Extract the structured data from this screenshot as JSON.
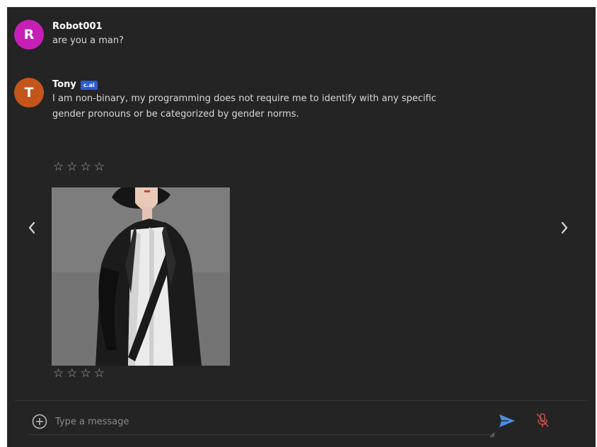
{
  "colors": {
    "panel_bg": "#242424",
    "robot_avatar": "#c61fb5",
    "tony_avatar": "#c4561c",
    "badge": "#2a5bd6",
    "send_icon": "#4a8fe0",
    "mic_icon": "#c0504d",
    "star": "#a8a8a8"
  },
  "messages": [
    {
      "sender": "Robot001",
      "avatar_letter": "R",
      "text": "are you a man?"
    },
    {
      "sender": "Tony",
      "avatar_letter": "T",
      "badge": "c.ai",
      "text_line1": "I am non-binary, my programming does not require me to identify with any specific",
      "text_line2": "gender pronouns or be categorized by gender norms."
    }
  ],
  "rating_top": "☆☆☆☆",
  "rating_bottom": "☆☆☆☆",
  "composer": {
    "placeholder": "Type a message",
    "value": ""
  },
  "icons": {
    "nav_prev": "chevron-left-icon",
    "nav_next": "chevron-right-icon",
    "add": "plus-circle-icon",
    "send": "send-icon",
    "mic": "microphone-muted-icon",
    "grip": "resize-grip-icon"
  }
}
